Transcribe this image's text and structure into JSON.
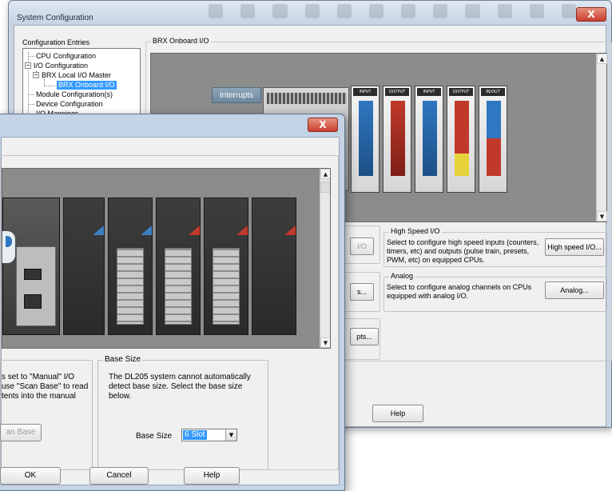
{
  "back_window": {
    "title": "System Configuration",
    "close_glyph": "X",
    "tree_heading": "Configuration Entries",
    "tree": [
      {
        "label": "CPU Configuration"
      },
      {
        "label": "I/O Configuration",
        "expander": "−"
      },
      {
        "label": "BRX Local I/O Master",
        "expander": "−"
      },
      {
        "label": "BRX Onboard I/O",
        "selected": true
      },
      {
        "label": "Module Configuration(s)"
      },
      {
        "label": "Device Configuration"
      },
      {
        "label": "I/O Mappings"
      }
    ],
    "onboard_group_title": "BRX Onboard I/O",
    "interrupts_label": "Interrupts",
    "module_headers": [
      "INPUT",
      "OUTPUT",
      "INPUT",
      "OUTPUT",
      "IN/OUT"
    ],
    "high_speed": {
      "title": "High Speed I/O",
      "description": "Select to configure high speed inputs (counters, timers, etc) and outputs (pulse train, presets, PWM, etc) on equipped CPUs.",
      "button_label": "High speed I/O..."
    },
    "analog": {
      "title": "Analog",
      "description": "Select to configure analog channels on CPUs equipped with analog I/O.",
      "button_label": "Analog..."
    },
    "partial_labels": [
      "I/O",
      "s...",
      "pts..."
    ],
    "help_label": "Help"
  },
  "front_window": {
    "close_glyph": "X",
    "left_text": "s set to \"Manual\" I/O\nuse \"Scan Base\" to read\ntents into the manual",
    "scan_base_label": "an Base",
    "base_size_group": {
      "legend": "Base Size",
      "description": "The DL205 system cannot automatically detect base size. Select the base size below.",
      "field_label": "Base Size",
      "selected_value": "6 Slot"
    },
    "buttons": {
      "ok": "OK",
      "cancel": "Cancel",
      "help": "Help"
    }
  },
  "colors": {
    "accent": "#3399ff",
    "close_red": "#c8402d",
    "module_blue": "#2f77c0",
    "module_red": "#c0392b"
  }
}
